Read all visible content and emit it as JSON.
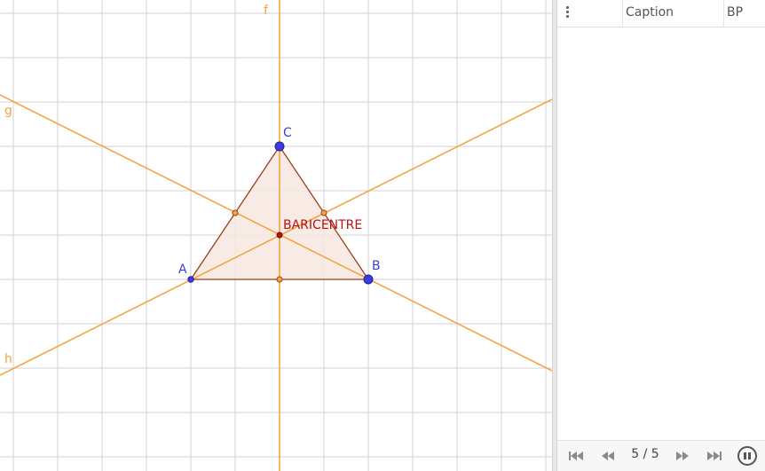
{
  "graphics": {
    "labels": {
      "line_f": "f",
      "line_g": "g",
      "line_h": "h",
      "point_a": "A",
      "point_b": "B",
      "point_c": "C",
      "centroid": "BARICENTRE"
    },
    "colors": {
      "grid": "#c8c8c8",
      "median_lines": "#f3a641",
      "triangle_edge": "#9c3c14",
      "triangle_fill": "#f7e8e0",
      "vertex_points": "#3c3cdc",
      "centroid_label": "#b41414",
      "line_labels": "#f3a641"
    }
  },
  "construction_protocol": {
    "columns": [
      "Caption",
      "BP"
    ],
    "menu_icon": "vertical-dots-icon",
    "navigation": {
      "counter": "5 / 5",
      "buttons": [
        "skip-to-first-icon",
        "step-back-icon",
        "step-forward-icon",
        "skip-to-last-icon",
        "pause-icon"
      ]
    }
  }
}
